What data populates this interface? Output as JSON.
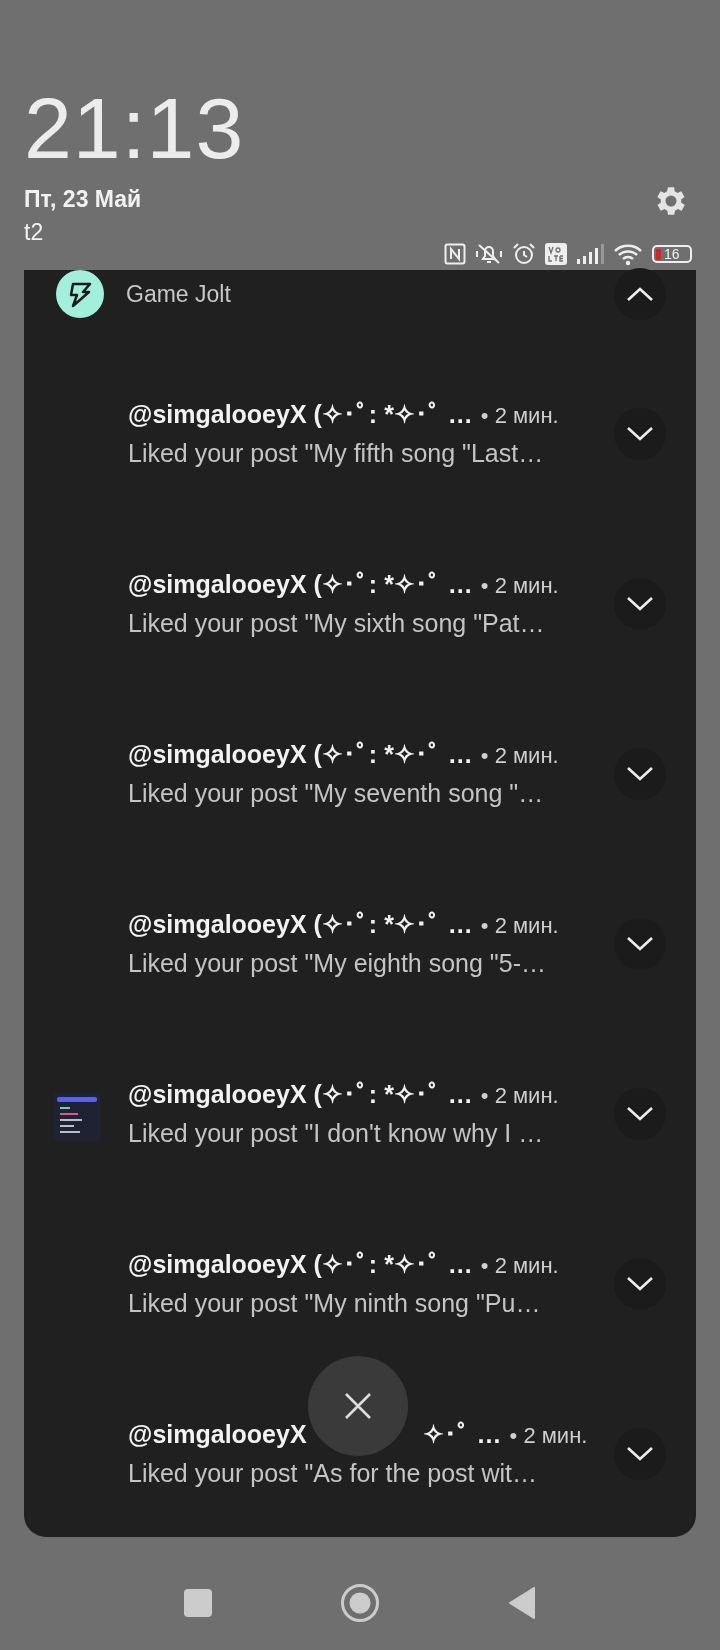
{
  "lock_header": {
    "time": "21:13",
    "date": "Пт, 23 Май",
    "carrier": "t2",
    "battery": "16"
  },
  "group": {
    "app_name": "Game Jolt",
    "expanded": true,
    "notifications": [
      {
        "title": "@simgalooeyX (✧･ﾟ: *✧･ﾟ …",
        "time": "• 2 мин.",
        "text": "Liked your post \"My fifth song \"Last…",
        "thumbnail": false
      },
      {
        "title": "@simgalooeyX (✧･ﾟ: *✧･ﾟ …",
        "time": "• 2 мин.",
        "text": "Liked your post \"My sixth song \"Pat…",
        "thumbnail": false
      },
      {
        "title": "@simgalooeyX (✧･ﾟ: *✧･ﾟ …",
        "time": "• 2 мин.",
        "text": "Liked your post \"My seventh song \"…",
        "thumbnail": false
      },
      {
        "title": "@simgalooeyX (✧･ﾟ: *✧･ﾟ …",
        "time": "• 2 мин.",
        "text": "Liked your post \"My eighth song \"5-…",
        "thumbnail": false
      },
      {
        "title": "@simgalooeyX (✧･ﾟ: *✧･ﾟ …",
        "time": "• 2 мин.",
        "text": "Liked your post \"I don't know why I …",
        "thumbnail": true
      },
      {
        "title": "@simgalooeyX (✧･ﾟ: *✧･ﾟ …",
        "time": "• 2 мин.",
        "text": "Liked your post \"My ninth song \"Pu…",
        "thumbnail": false
      },
      {
        "title": "@simgalooeyX",
        "title_end": "✧･ﾟ …",
        "time": "• 2 мин.",
        "text": "Liked your post \"As for the post wit…",
        "thumbnail": false
      }
    ]
  }
}
